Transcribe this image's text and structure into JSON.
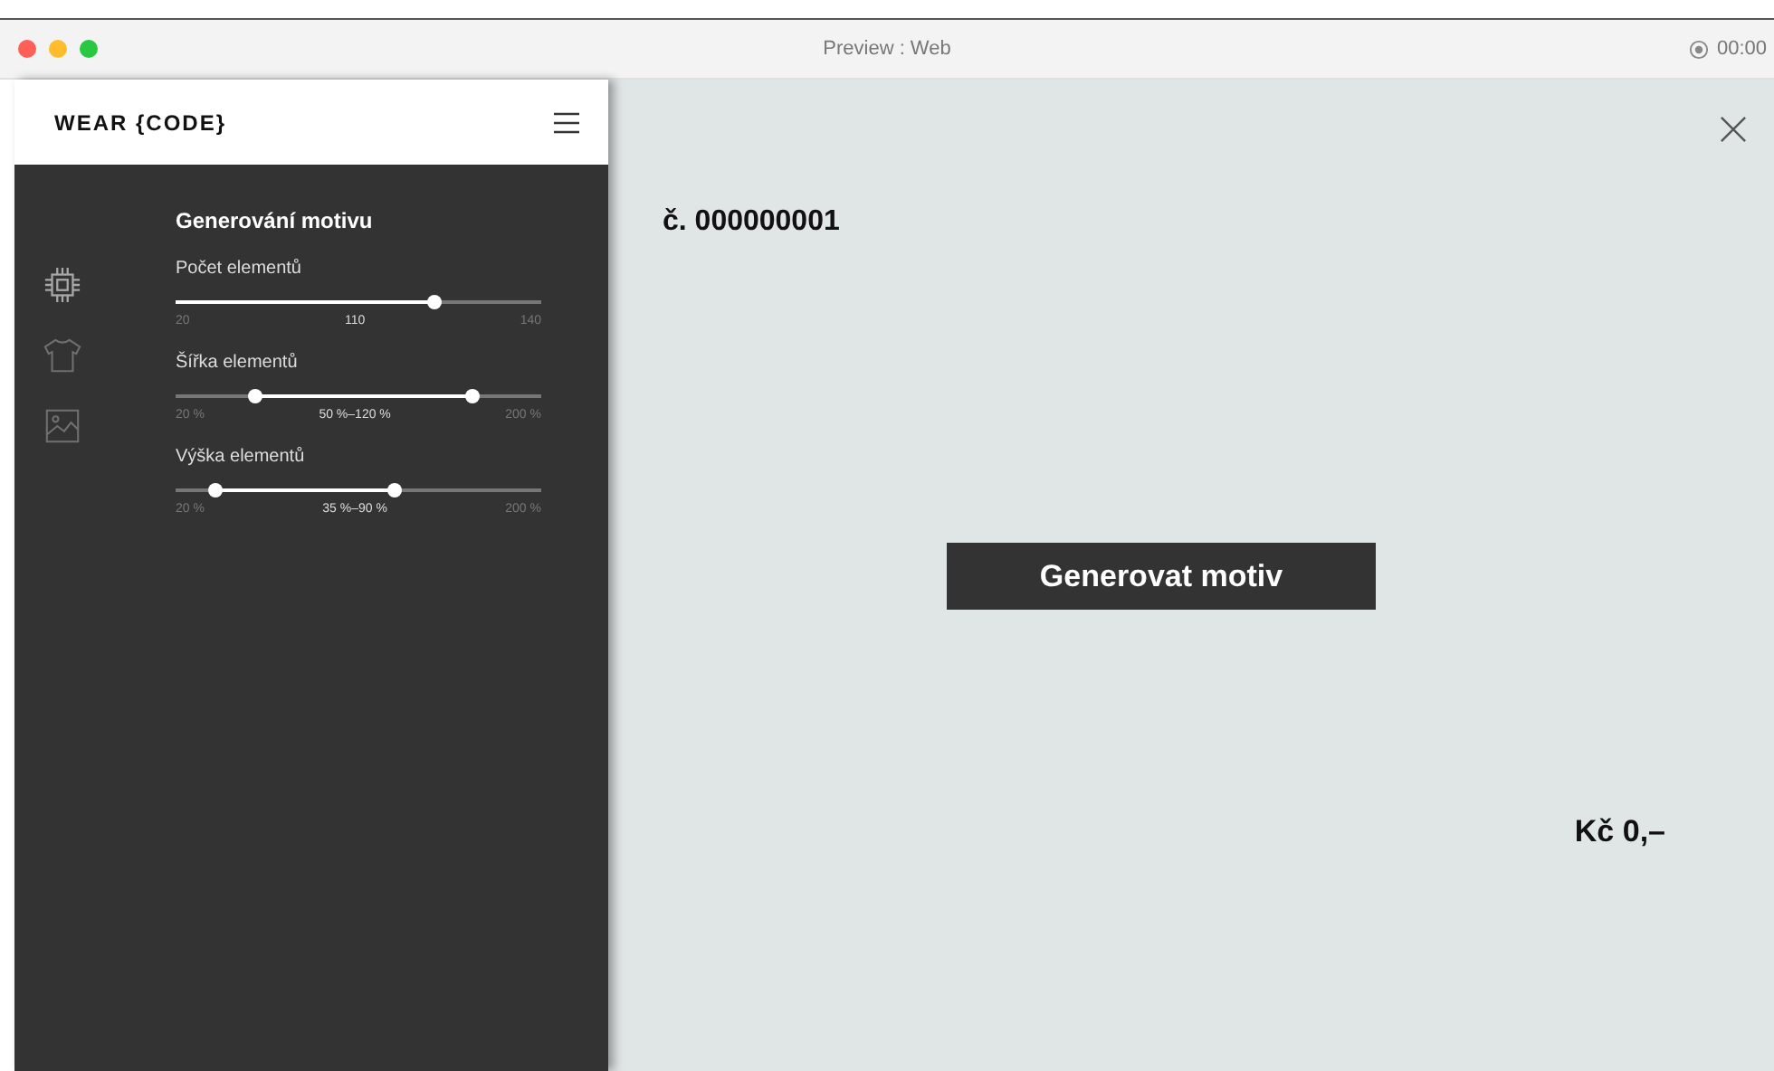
{
  "window": {
    "title": "Preview : Web",
    "timer": "00:00"
  },
  "sidebar": {
    "logo": "WEAR {CODE}",
    "nav": [
      {
        "kind": "chip",
        "selected": true
      },
      {
        "kind": "shirt",
        "selected": false
      },
      {
        "kind": "image",
        "selected": false
      }
    ],
    "title": "Generování motivu",
    "sliders": [
      {
        "label": "Počet elementů",
        "kind": "single",
        "thumbs": [
          {
            "level": 0.71
          }
        ],
        "min": "20",
        "value": "110",
        "max": "140"
      },
      {
        "label": "Šířka elementů",
        "kind": "range",
        "thumbs": [
          {
            "level": 0.22
          },
          {
            "level": 0.81
          }
        ],
        "min": "20 %",
        "value": "50 %–120 %",
        "max": "200 %"
      },
      {
        "label": "Výška elementů",
        "kind": "range",
        "thumbs": [
          {
            "level": 0.11
          },
          {
            "level": 0.6
          }
        ],
        "min": "20 %",
        "value": "35 %–90 %",
        "max": "200 %"
      }
    ]
  },
  "main": {
    "number": "č. 000000001",
    "button": "Generovat motiv",
    "price": "Kč 0,–"
  }
}
